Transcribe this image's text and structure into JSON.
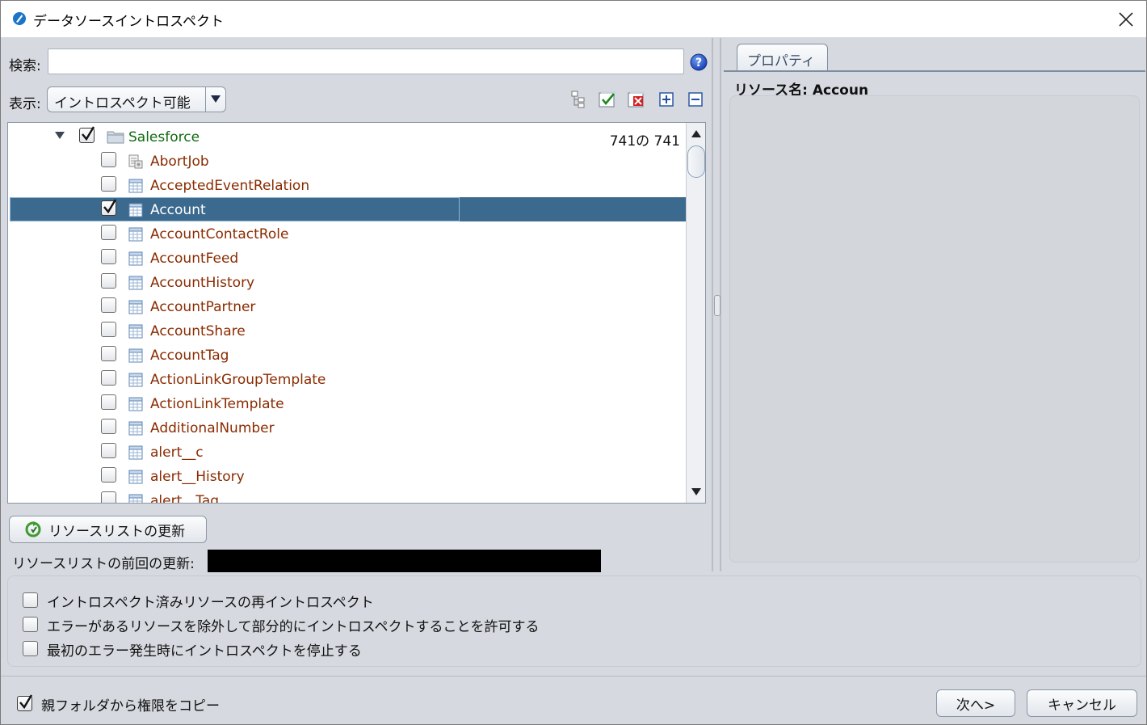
{
  "window": {
    "title": "データソースイントロスペクト"
  },
  "search": {
    "label": "検索:",
    "value": "",
    "placeholder": ""
  },
  "display": {
    "label": "表示:",
    "selected": "イントロスペクト可能"
  },
  "toolbar_icons": [
    "tree-structure-icon",
    "check-all-icon",
    "uncheck-all-icon",
    "expand-all-icon",
    "collapse-all-icon"
  ],
  "tree": {
    "root": {
      "label": "Salesforce",
      "count": "741の 741",
      "checked": true,
      "expanded": true
    },
    "items": [
      {
        "label": "AbortJob",
        "checked": false,
        "icon": "procedure-icon"
      },
      {
        "label": "AcceptedEventRelation",
        "checked": false,
        "icon": "table-icon"
      },
      {
        "label": "Account",
        "checked": true,
        "icon": "table-icon",
        "selected": true
      },
      {
        "label": "AccountContactRole",
        "checked": false,
        "icon": "table-icon"
      },
      {
        "label": "AccountFeed",
        "checked": false,
        "icon": "table-icon"
      },
      {
        "label": "AccountHistory",
        "checked": false,
        "icon": "table-icon"
      },
      {
        "label": "AccountPartner",
        "checked": false,
        "icon": "table-icon"
      },
      {
        "label": "AccountShare",
        "checked": false,
        "icon": "table-icon"
      },
      {
        "label": "AccountTag",
        "checked": false,
        "icon": "table-icon"
      },
      {
        "label": "ActionLinkGroupTemplate",
        "checked": false,
        "icon": "table-icon"
      },
      {
        "label": "ActionLinkTemplate",
        "checked": false,
        "icon": "table-icon"
      },
      {
        "label": "AdditionalNumber",
        "checked": false,
        "icon": "table-icon"
      },
      {
        "label": "alert__c",
        "checked": false,
        "icon": "table-icon"
      },
      {
        "label": "alert__History",
        "checked": false,
        "icon": "table-icon"
      },
      {
        "label": "alert__Tag",
        "checked": false,
        "icon": "table-icon"
      }
    ]
  },
  "refresh": {
    "button_label": "リソースリストの更新",
    "last_update_label": "リソースリストの前回の更新:"
  },
  "properties": {
    "tab_label": "プロパティ",
    "resource_name": "リソース名: Accoun"
  },
  "options": [
    {
      "label": "イントロスペクト済みリソースの再イントロスペクト",
      "checked": false
    },
    {
      "label": "エラーがあるリソースを除外して部分的にイントロスペクトすることを許可する",
      "checked": false
    },
    {
      "label": "最初のエラー発生時にイントロスペクトを停止する",
      "checked": false
    }
  ],
  "copy_permissions": {
    "label": "親フォルダから権限をコピー",
    "checked": true
  },
  "buttons": {
    "next": "次へ>",
    "cancel": "キャンセル"
  },
  "colors": {
    "selection": "#3b6a8e",
    "item_text": "#8a2b00",
    "root_text": "#116a12",
    "background": "#d6d9df"
  }
}
